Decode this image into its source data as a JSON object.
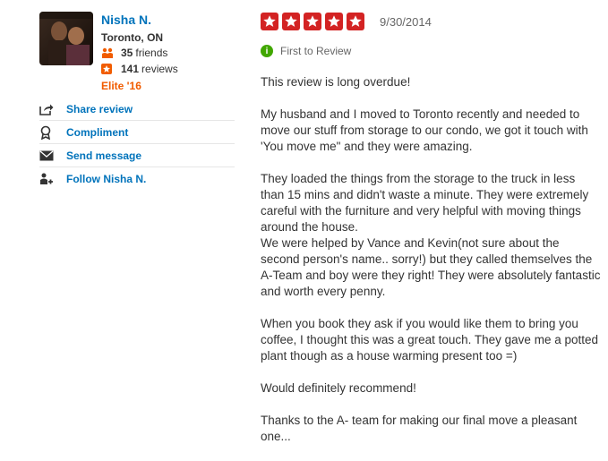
{
  "user": {
    "name": "Nisha N.",
    "location": "Toronto, ON",
    "friends_count": "35",
    "friends_label": "friends",
    "reviews_count": "141",
    "reviews_label": "reviews",
    "elite": "Elite '16"
  },
  "actions": [
    {
      "label": "Share review",
      "icon": "share-icon"
    },
    {
      "label": "Compliment",
      "icon": "compliment-icon"
    },
    {
      "label": "Send message",
      "icon": "message-icon"
    },
    {
      "label": "Follow Nisha N.",
      "icon": "follow-icon"
    }
  ],
  "review": {
    "rating": 5,
    "rating_max": 5,
    "date": "9/30/2014",
    "badge_label": "First to Review",
    "paragraphs": [
      "This review is long overdue!",
      "My husband and I moved to Toronto recently and needed to move our stuff from storage to our condo, we got it touch with 'You move me\" and they were amazing.",
      "They loaded the things from the storage to the truck in less than 15 mins and didn't waste a minute. They were extremely careful with the furniture and very helpful with moving things around the house.\nWe were helped by Vance and Kevin(not sure about the second person's name.. sorry!) but they called themselves the A-Team and boy were they right! They were absolutely fantastic and worth every penny.",
      "When you book they ask if you would like them to bring you coffee, I thought this was a great touch. They gave me a potted plant though as a house warming present too =)",
      "Would definitely recommend!",
      "Thanks to the A- team for making our final move a pleasant one..."
    ]
  },
  "colors": {
    "link": "#0073bb",
    "star": "#d32323",
    "elite": "#f15c00",
    "badge": "#41a700"
  }
}
